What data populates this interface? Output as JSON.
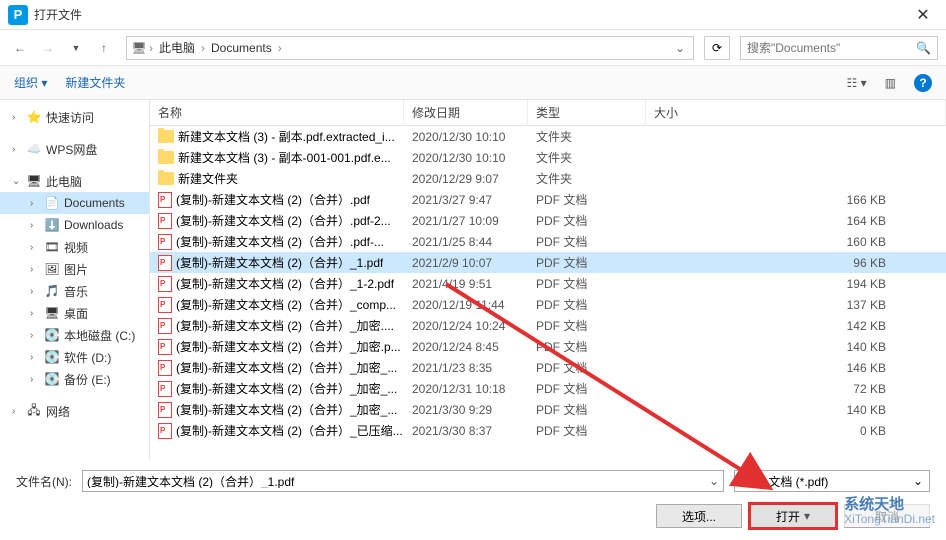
{
  "title": "打开文件",
  "breadcrumb": {
    "root": "此电脑",
    "folder": "Documents"
  },
  "search_placeholder": "搜索\"Documents\"",
  "toolbar": {
    "organize": "组织",
    "newfolder": "新建文件夹"
  },
  "columns": {
    "name": "名称",
    "date": "修改日期",
    "type": "类型",
    "size": "大小"
  },
  "sidebar": {
    "quick": "快速访问",
    "wps": "WPS网盘",
    "thispc": "此电脑",
    "documents": "Documents",
    "downloads": "Downloads",
    "videos": "视频",
    "pictures": "图片",
    "music": "音乐",
    "desktop": "桌面",
    "diskc": "本地磁盘 (C:)",
    "diskd": "软件 (D:)",
    "diske": "备份 (E:)",
    "network": "网络"
  },
  "files": [
    {
      "name": "新建文本文档 (3) - 副本.pdf.extracted_i...",
      "date": "2020/12/30 10:10",
      "type": "文件夹",
      "size": "",
      "kind": "folder"
    },
    {
      "name": "新建文本文档 (3) - 副本-001-001.pdf.e...",
      "date": "2020/12/30 10:10",
      "type": "文件夹",
      "size": "",
      "kind": "folder"
    },
    {
      "name": "新建文件夹",
      "date": "2020/12/29 9:07",
      "type": "文件夹",
      "size": "",
      "kind": "folder"
    },
    {
      "name": "(复制)-新建文本文档 (2)（合并）.pdf",
      "date": "2021/3/27 9:47",
      "type": "PDF 文档",
      "size": "166 KB",
      "kind": "pdf"
    },
    {
      "name": "(复制)-新建文本文档 (2)（合并）.pdf-2...",
      "date": "2021/1/27 10:09",
      "type": "PDF 文档",
      "size": "164 KB",
      "kind": "pdf"
    },
    {
      "name": "(复制)-新建文本文档 (2)（合并）.pdf-...",
      "date": "2021/1/25 8:44",
      "type": "PDF 文档",
      "size": "160 KB",
      "kind": "pdf"
    },
    {
      "name": "(复制)-新建文本文档 (2)（合并）_1.pdf",
      "date": "2021/2/9 10:07",
      "type": "PDF 文档",
      "size": "96 KB",
      "kind": "pdf",
      "selected": true
    },
    {
      "name": "(复制)-新建文本文档 (2)（合并）_1-2.pdf",
      "date": "2021/4/19 9:51",
      "type": "PDF 文档",
      "size": "194 KB",
      "kind": "pdf"
    },
    {
      "name": "(复制)-新建文本文档 (2)（合并）_comp...",
      "date": "2020/12/19 11:44",
      "type": "PDF 文档",
      "size": "137 KB",
      "kind": "pdf"
    },
    {
      "name": "(复制)-新建文本文档 (2)（合并）_加密....",
      "date": "2020/12/24 10:24",
      "type": "PDF 文档",
      "size": "142 KB",
      "kind": "pdf"
    },
    {
      "name": "(复制)-新建文本文档 (2)（合并）_加密.p...",
      "date": "2020/12/24 8:45",
      "type": "PDF 文档",
      "size": "140 KB",
      "kind": "pdf"
    },
    {
      "name": "(复制)-新建文本文档 (2)（合并）_加密_...",
      "date": "2021/1/23 8:35",
      "type": "PDF 文档",
      "size": "146 KB",
      "kind": "pdf"
    },
    {
      "name": "(复制)-新建文本文档 (2)（合并）_加密_...",
      "date": "2020/12/31 10:18",
      "type": "PDF 文档",
      "size": "72 KB",
      "kind": "pdf"
    },
    {
      "name": "(复制)-新建文本文档 (2)（合并）_加密_...",
      "date": "2021/3/30 9:29",
      "type": "PDF 文档",
      "size": "140 KB",
      "kind": "pdf"
    },
    {
      "name": "(复制)-新建文本文档 (2)（合并）_已压缩...",
      "date": "2021/3/30 8:37",
      "type": "PDF 文档",
      "size": "0 KB",
      "kind": "pdf"
    }
  ],
  "filename_label": "文件名(N):",
  "filename_value": "(复制)-新建文本文档 (2)（合并）_1.pdf",
  "filter_label": "PDF 文档 (*.pdf)",
  "options_label": "选项...",
  "open_label": "打开",
  "cancel_label": "取消",
  "watermark": {
    "cn": "系统天地",
    "en": "XiTongTianDi.net"
  }
}
